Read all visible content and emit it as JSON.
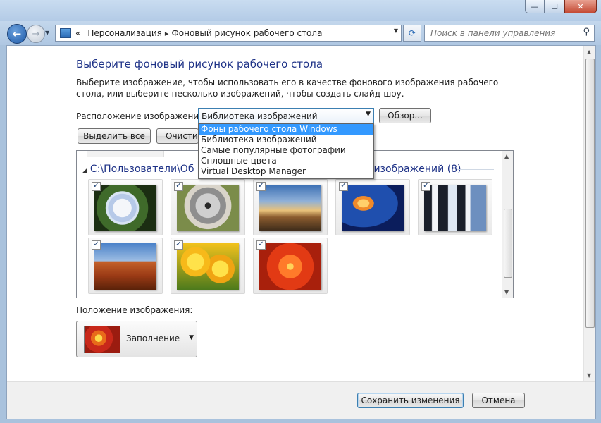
{
  "window": {
    "minimize_symbol": "—",
    "maximize_symbol": "☐",
    "close_symbol": "✕"
  },
  "nav": {
    "back_symbol": "←",
    "forward_symbol": "→",
    "breadcrumb_prefix": "«",
    "breadcrumb": [
      "Персонализация",
      "Фоновый рисунок рабочего стола"
    ],
    "breadcrumb_separator": "▸",
    "refresh_symbol": "⟳",
    "search_placeholder": "Поиск в панели управления",
    "search_icon": "magnifier-icon"
  },
  "page": {
    "title": "Выберите фоновый рисунок рабочего стола",
    "description": "Выберите изображение, чтобы использовать его в качестве фонового изображения рабочего стола, или выберите несколько изображений, чтобы создать слайд-шоу.",
    "location_label": "Расположение изображения:",
    "location_value": "Библиотека изображений",
    "browse_button": "Обзор...",
    "select_all_button": "Выделить все",
    "clear_all_button": "Очистить",
    "group_header_start": "C:\\Пользователи\\Об",
    "group_header_end": "изображений (8)",
    "position_label": "Положение изображения:",
    "position_value": "Заполнение",
    "save_button": "Сохранить изменения",
    "cancel_button": "Отмена"
  },
  "dropdown_options": [
    {
      "label": "Фоны рабочего стола Windows",
      "selected": true
    },
    {
      "label": "Библиотека изображений",
      "selected": false
    },
    {
      "label": "Самые популярные фотографии",
      "selected": false
    },
    {
      "label": "Сплошные цвета",
      "selected": false
    },
    {
      "label": "Virtual Desktop Manager",
      "selected": false
    }
  ],
  "thumbnails": [
    {
      "name": "hydrangeas",
      "checked": true
    },
    {
      "name": "koala",
      "checked": true
    },
    {
      "name": "lighthouse",
      "checked": true
    },
    {
      "name": "jellyfish",
      "checked": true
    },
    {
      "name": "penguins",
      "checked": true
    },
    {
      "name": "desert",
      "checked": true
    },
    {
      "name": "tulips",
      "checked": true
    },
    {
      "name": "chrysanthemum",
      "checked": true
    }
  ],
  "checkmark": "✓"
}
